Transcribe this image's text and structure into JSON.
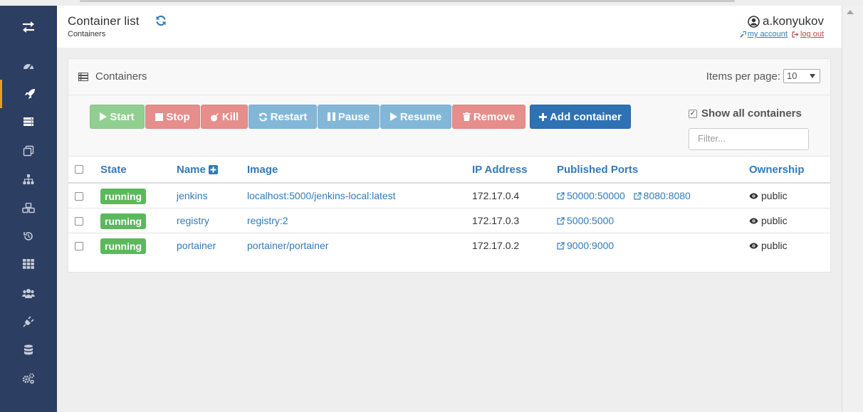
{
  "header": {
    "title": "Container list",
    "breadcrumb": "Containers",
    "username": "a.konyukov",
    "my_account": "my account",
    "log_out": "log out"
  },
  "panel": {
    "title": "Containers",
    "items_per_page_label": "Items per page:",
    "items_per_page_value": "10"
  },
  "toolbar": {
    "start": "Start",
    "stop": "Stop",
    "kill": "Kill",
    "restart": "Restart",
    "pause": "Pause",
    "resume": "Resume",
    "remove": "Remove",
    "add_container": "Add container",
    "show_all": "Show all containers",
    "filter_placeholder": "Filter..."
  },
  "table": {
    "headers": {
      "state": "State",
      "name": "Name",
      "image": "Image",
      "ip": "IP Address",
      "ports": "Published Ports",
      "ownership": "Ownership"
    },
    "rows": [
      {
        "state": "running",
        "name": "jenkins",
        "image": "localhost:5000/jenkins-local:latest",
        "ip": "172.17.0.4",
        "ports": [
          "50000:50000",
          "8080:8080"
        ],
        "ownership": "public"
      },
      {
        "state": "running",
        "name": "registry",
        "image": "registry:2",
        "ip": "172.17.0.3",
        "ports": [
          "5000:5000"
        ],
        "ownership": "public"
      },
      {
        "state": "running",
        "name": "portainer",
        "image": "portainer/portainer",
        "ip": "172.17.0.2",
        "ports": [
          "9000:9000"
        ],
        "ownership": "public"
      }
    ]
  },
  "colors": {
    "sidebar": "#2d3e63",
    "accent": "#e99d1a",
    "link": "#337ab7",
    "running": "#5cb85c",
    "primary": "#2f72b4"
  },
  "sidebar_icons": [
    "transfer-icon",
    "dashboard-icon",
    "rocket-icon",
    "server-icon",
    "clone-icon",
    "sitemap-icon",
    "cubes-icon",
    "history-icon",
    "grid-icon",
    "users-icon",
    "plug-icon",
    "database-icon",
    "cogs-icon"
  ]
}
